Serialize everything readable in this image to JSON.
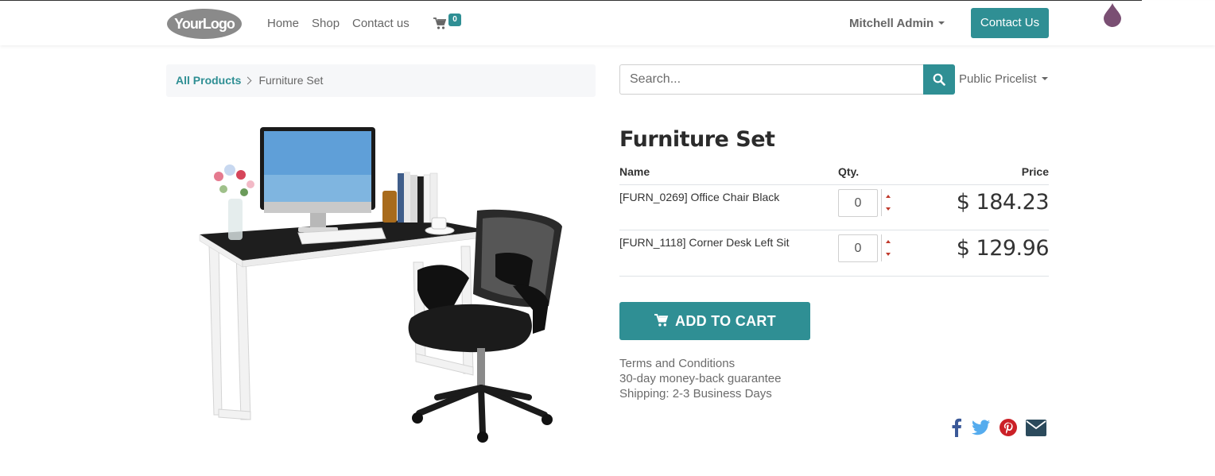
{
  "header": {
    "logo_text": "YourLogo",
    "nav": [
      "Home",
      "Shop",
      "Contact us"
    ],
    "cart_count": "0",
    "user_name": "Mitchell Admin",
    "contact_button": "Contact Us"
  },
  "breadcrumb": {
    "parent": "All Products",
    "current": "Furniture Set"
  },
  "search": {
    "placeholder": "Search...",
    "pricelist": "Public Pricelist"
  },
  "product": {
    "title": "Furniture Set",
    "columns": {
      "name": "Name",
      "qty": "Qty.",
      "price": "Price"
    },
    "items": [
      {
        "name": "[FURN_0269] Office Chair Black",
        "qty": "0",
        "price": "$ 184.23"
      },
      {
        "name": "[FURN_1118] Corner Desk Left Sit",
        "qty": "0",
        "price": "$ 129.96"
      }
    ],
    "add_to_cart": "ADD TO CART",
    "info": [
      "Terms and Conditions",
      "30-day money-back guarantee",
      "Shipping: 2-3 Business Days"
    ]
  },
  "share_icons": [
    "facebook-icon",
    "twitter-icon",
    "pinterest-icon",
    "email-icon"
  ],
  "colors": {
    "accent": "#2f8f94",
    "facebook": "#3b5998",
    "twitter": "#55acee",
    "pinterest": "#cb2027",
    "email": "#2b4a5c",
    "drop": "#7a4f73"
  }
}
